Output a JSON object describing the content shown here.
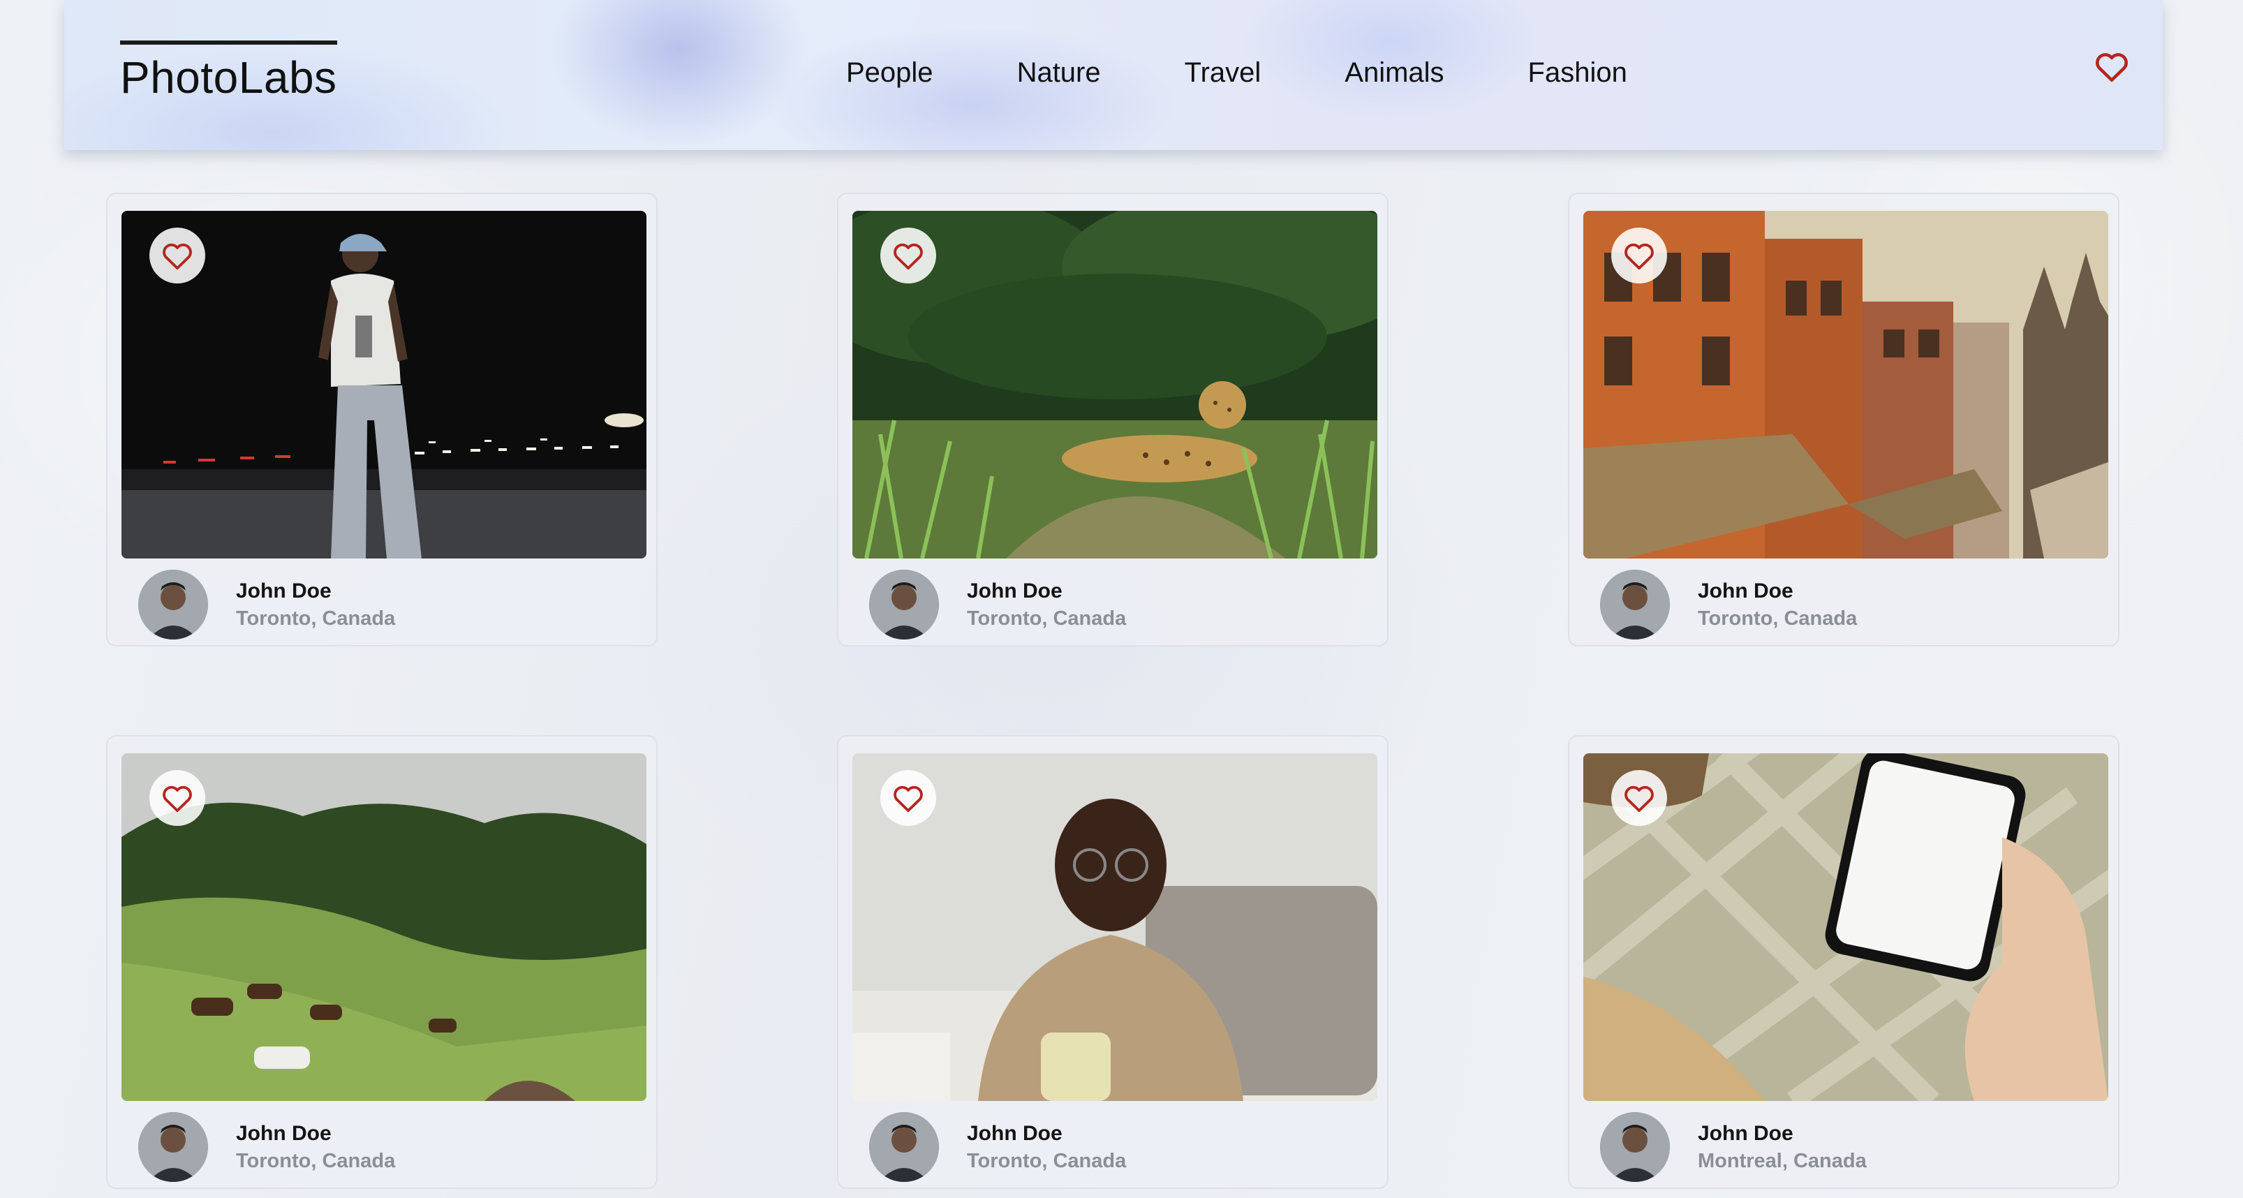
{
  "app": {
    "title": "PhotoLabs"
  },
  "nav": {
    "items": [
      {
        "label": "People"
      },
      {
        "label": "Nature"
      },
      {
        "label": "Travel"
      },
      {
        "label": "Animals"
      },
      {
        "label": "Fashion"
      }
    ]
  },
  "colors": {
    "accent": "#b3261e",
    "text": "#111111",
    "muted": "#8a8f96"
  },
  "header": {
    "favorites_icon": "heart-outline-icon"
  },
  "photos": [
    {
      "subject": "person-night-street",
      "user": {
        "name": "John Doe",
        "location": "Toronto, Canada"
      }
    },
    {
      "subject": "jaguar-in-grass",
      "user": {
        "name": "John Doe",
        "location": "Toronto, Canada"
      }
    },
    {
      "subject": "city-buildings",
      "user": {
        "name": "John Doe",
        "location": "Toronto, Canada"
      }
    },
    {
      "subject": "horses-grazing",
      "user": {
        "name": "John Doe",
        "location": "Toronto, Canada"
      }
    },
    {
      "subject": "smiling-man-with-mug",
      "user": {
        "name": "John Doe",
        "location": "Toronto, Canada"
      }
    },
    {
      "subject": "hand-holding-phone",
      "user": {
        "name": "John Doe",
        "location": "Montreal, Canada"
      }
    }
  ]
}
